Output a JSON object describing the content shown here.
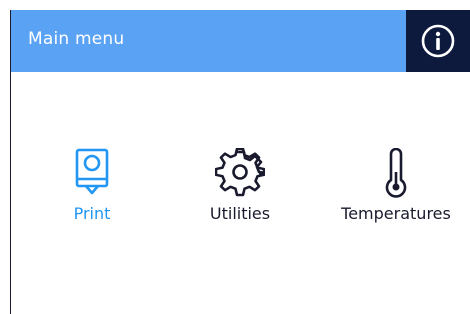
{
  "header": {
    "title": "Main menu",
    "info_icon": "info-icon",
    "background_color": "#5aa2f4",
    "info_background_color": "#0d1a3d"
  },
  "menu": {
    "active_color": "#2196f3",
    "items": [
      {
        "label": "Print",
        "icon": "printer-icon",
        "active": true
      },
      {
        "label": "Utilities",
        "icon": "gear-icon",
        "active": false
      },
      {
        "label": "Temperatures",
        "icon": "thermometer-icon",
        "active": false
      }
    ]
  }
}
